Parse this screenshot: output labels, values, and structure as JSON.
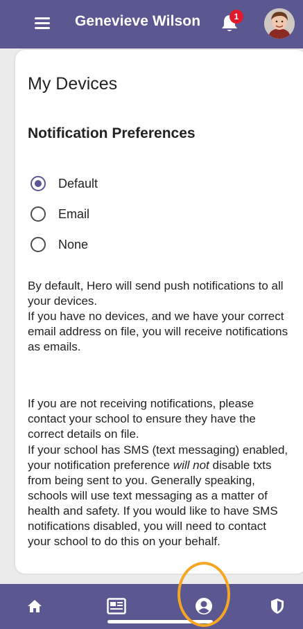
{
  "header": {
    "title": "Genevieve Wilson",
    "notification_count": "1",
    "icons": {
      "menu": "hamburger-menu-icon",
      "notifications": "bell-icon",
      "avatar": "user-avatar"
    }
  },
  "main": {
    "page_title": "My Devices",
    "section_title": "Notification Preferences",
    "options": [
      {
        "label": "Default",
        "checked": true
      },
      {
        "label": "Email",
        "checked": false
      },
      {
        "label": "None",
        "checked": false
      }
    ],
    "paragraphs": {
      "p1_line1": "By default, Hero will send push notifications to all your devices.",
      "p1_line2": "If you have no devices, and we have your correct email address on file, you will receive notifications as emails.",
      "p2": "If you are not receiving notifications, please contact your school to ensure they have the correct details on file.",
      "p3_before": "If your school has SMS (text messaging) enabled, your notification preference ",
      "p3_emphasis": "will not",
      "p3_after": " disable txts from being sent to you. Generally speaking, schools will use text messaging as a matter of health and safety. If you would like to have SMS notifications disabled, you will need to contact your school to do this on your behalf."
    }
  },
  "bottom_nav": {
    "items": [
      {
        "icon": "home-icon"
      },
      {
        "icon": "newsfeed-icon"
      },
      {
        "icon": "profile-icon",
        "active": true
      },
      {
        "icon": "shield-icon"
      }
    ]
  },
  "colors": {
    "brand": "#5b5891",
    "badge": "#e0192b",
    "highlight": "#f5a623"
  }
}
